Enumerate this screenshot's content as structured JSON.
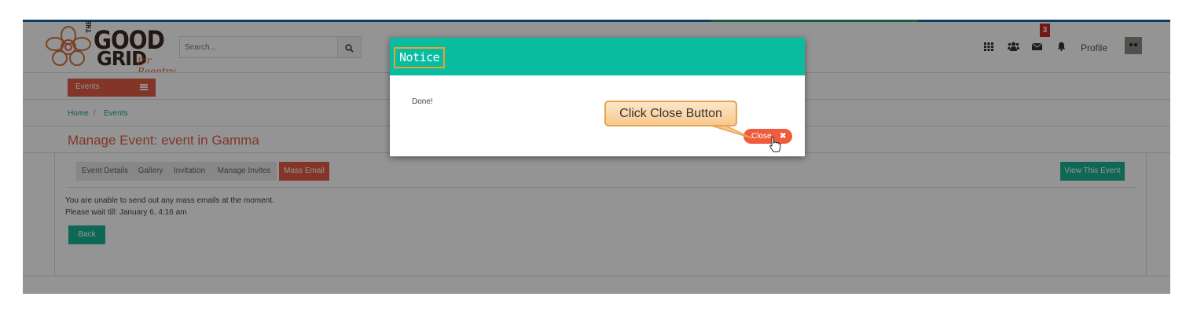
{
  "header": {
    "logo": {
      "the": "THE",
      "good": "GOOD",
      "grid": "GRID",
      "tagline": "for Reentry"
    },
    "search_placeholder": "Search...",
    "icons": [
      "grid-icon",
      "users-icon",
      "envelope-icon",
      "bell-icon"
    ],
    "notification_count": "3",
    "profile_label": "Profile"
  },
  "subnav": {
    "events_label": "Events"
  },
  "breadcrumb": {
    "home": "Home",
    "separator": "/",
    "current": "Events"
  },
  "page_title": "Manage Event: event in Gamma",
  "tabs": [
    {
      "label": "Event Details",
      "active": false
    },
    {
      "label": "Gallery",
      "active": false
    },
    {
      "label": "Invitation",
      "active": false
    },
    {
      "label": "Manage Invites",
      "active": false
    },
    {
      "label": "Mass Email",
      "active": true
    }
  ],
  "view_event_label": "View This Event",
  "messages": {
    "line1": "You are unable to send out any mass emails at the moment.",
    "line2": "Please wait till: January 6, 4:16 am"
  },
  "back_label": "Back",
  "modal": {
    "title": "Notice",
    "body": "Done!",
    "close_label": "Close",
    "close_symbol": "✖"
  },
  "callout": {
    "text": "Click Close Button"
  },
  "colors": {
    "accent_red": "#e25e45",
    "teal": "#1ab394",
    "modal_header": "#08bd9f",
    "close_button": "#ef5b3b",
    "callout_border": "#e6a452"
  }
}
